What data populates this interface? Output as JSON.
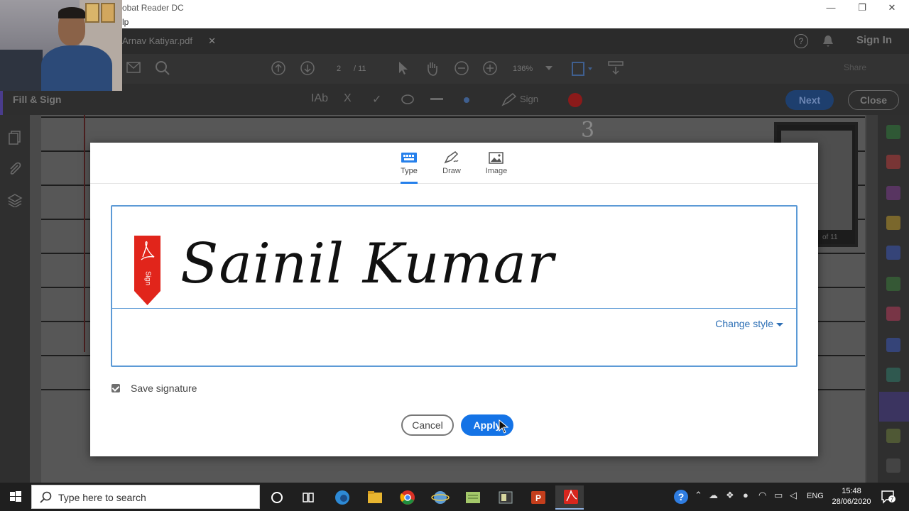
{
  "window": {
    "title": "obat Reader DC",
    "menu_fragment": "lp",
    "minimize": "—",
    "restore": "❐",
    "close": "✕"
  },
  "tabbar": {
    "document_tab": "Arnav Katiyar.pdf",
    "tab_close": "✕",
    "help": "?",
    "sign_in": "Sign In"
  },
  "toolbar": {
    "page_current": "2",
    "page_total": "/ 11",
    "zoom": "136%",
    "share": "Share"
  },
  "fill_sign": {
    "title": "Fill & Sign",
    "text_tool": "IAb",
    "cross_tool": "X",
    "check_tool": "✓",
    "sign_label": "Sign",
    "next": "Next",
    "close": "Close"
  },
  "document": {
    "thumbnail_label": "of 11",
    "ink_digit": "3"
  },
  "signature_dialog": {
    "tabs": [
      {
        "label": "Type"
      },
      {
        "label": "Draw"
      },
      {
        "label": "Image"
      }
    ],
    "flag_text": "Sign",
    "signature_text": "Sainil Kumar",
    "change_style": "Change style",
    "save_signature": "Save signature",
    "cancel": "Cancel",
    "apply": "Apply"
  },
  "taskbar": {
    "search_placeholder": "Type here to search",
    "language": "ENG",
    "time": "15:48",
    "date": "28/06/2020",
    "notifications": "7"
  },
  "colors": {
    "accent": "#1473e6",
    "box_border": "#5c9ad6",
    "flag_red": "#e1251b",
    "link": "#2d6fb5"
  }
}
